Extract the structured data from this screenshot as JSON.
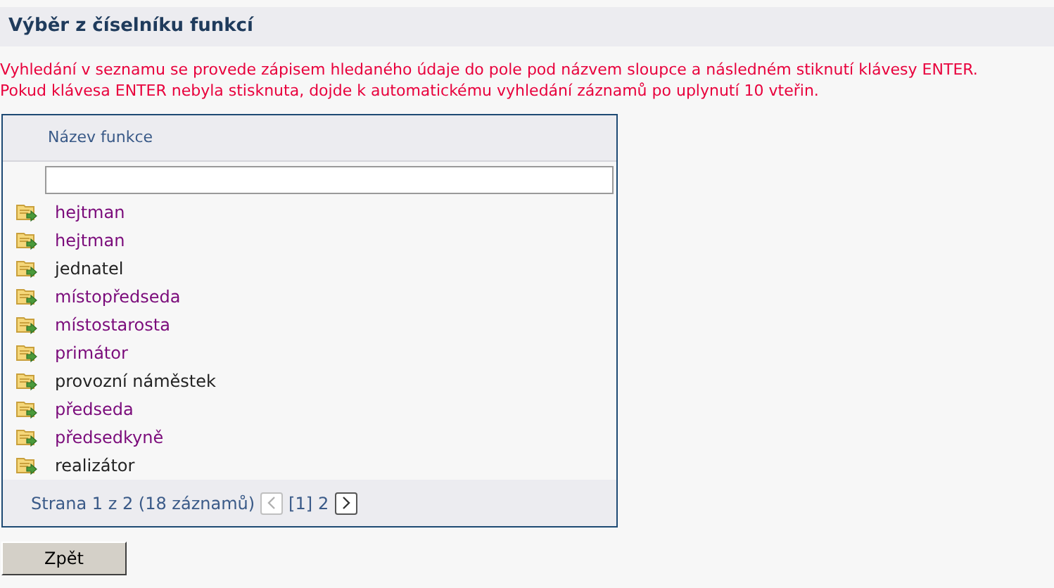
{
  "title": "Výběr z číselníku funkcí",
  "notice": [
    "Vyhledání v seznamu se provede zápisem hledaného údaje do pole pod názvem sloupce a následném stiknutí klávesy ENTER.",
    "Pokud klávesa ENTER nebyla stisknuta, dojde k automatickému vyhledání záznamů po uplynutí 10 vteřin."
  ],
  "table": {
    "columns": [
      "Název funkce"
    ],
    "rows": [
      {
        "label": "hejtman",
        "visited": true
      },
      {
        "label": "hejtman",
        "visited": true
      },
      {
        "label": "jednatel",
        "visited": false
      },
      {
        "label": "místopředseda",
        "visited": true
      },
      {
        "label": "místostarosta",
        "visited": true
      },
      {
        "label": "primátor",
        "visited": true
      },
      {
        "label": "provozní náměstek",
        "visited": false
      },
      {
        "label": "předseda",
        "visited": true
      },
      {
        "label": "předsedkyně",
        "visited": true
      },
      {
        "label": "realizátor",
        "visited": false
      }
    ],
    "pager": {
      "summary": "Strana 1 z 2 (18 záznamů)",
      "prev_disabled": true,
      "next_disabled": false,
      "pages": [
        "[1]",
        "2"
      ]
    }
  },
  "back_button": "Zpět"
}
